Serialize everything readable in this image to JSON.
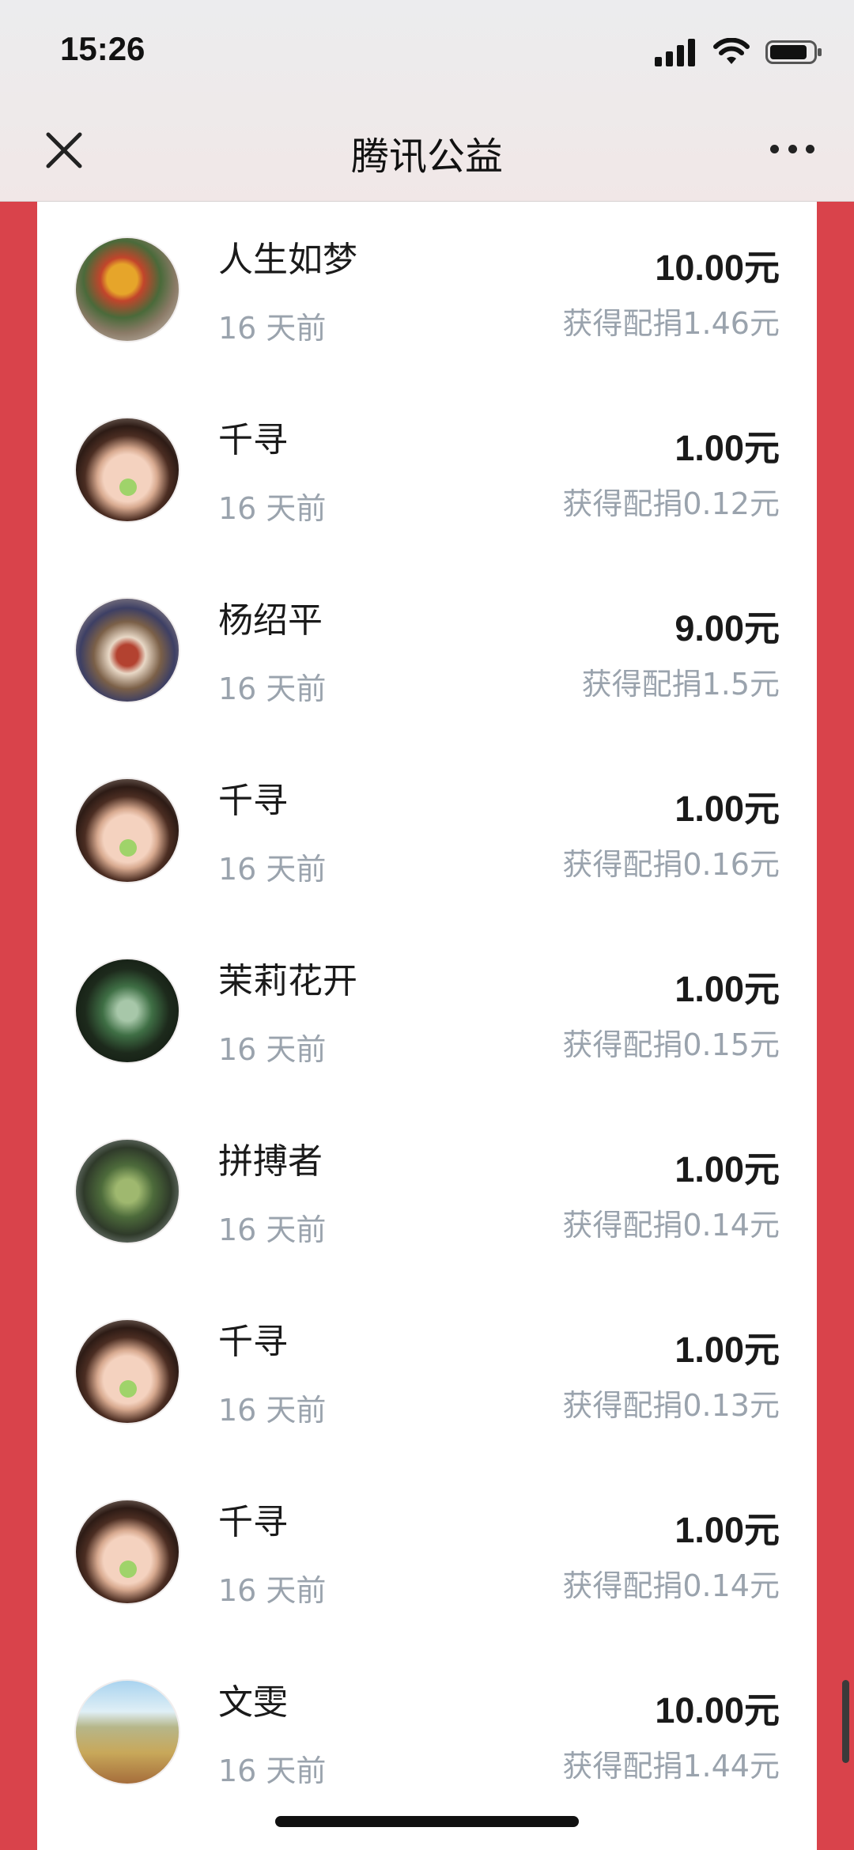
{
  "status_bar": {
    "time": "15:26"
  },
  "nav": {
    "title": "腾讯公益",
    "close_icon": "close-icon",
    "more_icon": "more-dots-icon"
  },
  "colors": {
    "background_red": "#d9434b",
    "card_white": "#ffffff",
    "primary_text": "#1a1a1a",
    "secondary_text": "#9aa3ad"
  },
  "donations": [
    {
      "name": "人生如梦",
      "time": "16 天前",
      "amount": "10.00元",
      "match": "获得配捐1.46元",
      "avatar": "flowers-avatar"
    },
    {
      "name": "千寻",
      "time": "16 天前",
      "amount": "1.00元",
      "match": "获得配捐0.12元",
      "avatar": "girl-avatar"
    },
    {
      "name": "杨绍平",
      "time": "16 天前",
      "amount": "9.00元",
      "match": "获得配捐1.5元",
      "avatar": "tea-avatar"
    },
    {
      "name": "千寻",
      "time": "16 天前",
      "amount": "1.00元",
      "match": "获得配捐0.16元",
      "avatar": "girl-avatar"
    },
    {
      "name": "茉莉花开",
      "time": "16 天前",
      "amount": "1.00元",
      "match": "获得配捐0.15元",
      "avatar": "plant-avatar"
    },
    {
      "name": "拼搏者",
      "time": "16 天前",
      "amount": "1.00元",
      "match": "获得配捐0.14元",
      "avatar": "grass-avatar"
    },
    {
      "name": "千寻",
      "time": "16 天前",
      "amount": "1.00元",
      "match": "获得配捐0.13元",
      "avatar": "girl-avatar"
    },
    {
      "name": "千寻",
      "time": "16 天前",
      "amount": "1.00元",
      "match": "获得配捐0.14元",
      "avatar": "girl-avatar"
    },
    {
      "name": "文雯",
      "time": "16 天前",
      "amount": "10.00元",
      "match": "获得配捐1.44元",
      "avatar": "field-avatar"
    }
  ]
}
